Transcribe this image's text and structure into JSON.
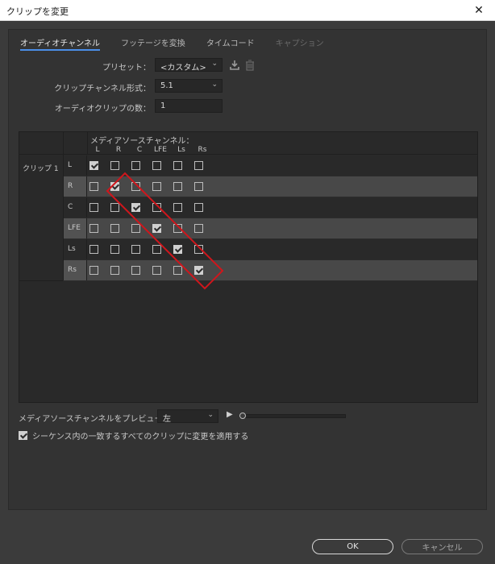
{
  "window": {
    "title": "クリップを変更",
    "close_glyph": "✕"
  },
  "tabs": [
    {
      "label": "オーディオチャンネル",
      "state": "active"
    },
    {
      "label": "フッテージを変換",
      "state": "normal"
    },
    {
      "label": "タイムコード",
      "state": "normal"
    },
    {
      "label": "キャプション",
      "state": "disabled"
    }
  ],
  "preset": {
    "label": "プリセット：",
    "value": "<カスタム>"
  },
  "format": {
    "label": "クリップチャンネル形式：",
    "value": "5.1"
  },
  "clip_count": {
    "label": "オーディオクリップの数：",
    "value": "1"
  },
  "matrix": {
    "source_title": "メディアソースチャンネル：",
    "columns": [
      "L",
      "R",
      "C",
      "LFE",
      "Ls",
      "Rs"
    ],
    "clip_label": "クリップ 1",
    "rows": [
      {
        "label": "L",
        "checked": [
          true,
          false,
          false,
          false,
          false,
          false
        ]
      },
      {
        "label": "R",
        "checked": [
          false,
          true,
          false,
          false,
          false,
          false
        ]
      },
      {
        "label": "C",
        "checked": [
          false,
          false,
          true,
          false,
          false,
          false
        ]
      },
      {
        "label": "LFE",
        "checked": [
          false,
          false,
          false,
          true,
          false,
          false
        ]
      },
      {
        "label": "Ls",
        "checked": [
          false,
          false,
          false,
          false,
          true,
          false
        ]
      },
      {
        "label": "Rs",
        "checked": [
          false,
          false,
          false,
          false,
          false,
          true
        ]
      }
    ]
  },
  "preview": {
    "label": "メディアソースチャンネルをプレビュー：",
    "value": "左",
    "slider_value": 0
  },
  "apply_all": {
    "label": "シーケンス内の一致するすべてのクリップに変更を適用する",
    "checked": true
  },
  "buttons": {
    "ok": "OK",
    "cancel": "キャンセル"
  },
  "colors": {
    "accent_tab": "#4b8ee8",
    "annotation": "#d0161c",
    "dialog_bg": "#3b3b3b"
  }
}
